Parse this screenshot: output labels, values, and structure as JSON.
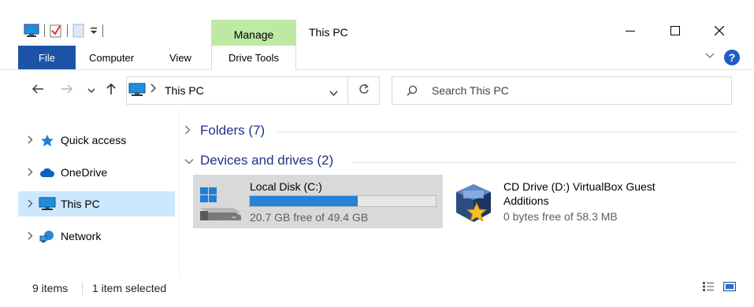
{
  "window": {
    "title": "This PC",
    "contextual_tab_group": "Manage",
    "contextual_color": "#bde9a4",
    "controls": {
      "minimize_icon": "minimize-icon",
      "maximize_icon": "maximize-icon",
      "close_icon": "close-icon"
    }
  },
  "quick_access_toolbar": {
    "icons": [
      "computer-properties-icon",
      "checkbox-icon",
      "new-folder-icon",
      "customize-dropdown-icon"
    ]
  },
  "ribbon": {
    "tabs": [
      {
        "label": "File",
        "active_color": "#1c53a7"
      },
      {
        "label": "Computer"
      },
      {
        "label": "View"
      },
      {
        "label": "Drive Tools"
      }
    ],
    "help_label": "?"
  },
  "address_bar": {
    "path": "This PC",
    "search_placeholder": "Search This PC"
  },
  "navigation_pane": {
    "items": [
      {
        "label": "Quick access",
        "icon": "star-icon",
        "selected": false
      },
      {
        "label": "OneDrive",
        "icon": "cloud-icon",
        "selected": false
      },
      {
        "label": "This PC",
        "icon": "monitor-icon",
        "selected": true
      },
      {
        "label": "Network",
        "icon": "network-icon",
        "selected": false
      }
    ]
  },
  "content": {
    "groups": [
      {
        "label": "Folders (7)",
        "expanded": false
      },
      {
        "label": "Devices and drives (2)",
        "expanded": true
      }
    ],
    "drives": [
      {
        "name": "Local Disk (C:)",
        "free_text": "20.7 GB free of 49.4 GB",
        "used_fraction": 0.581,
        "bar_color": "#2682d5",
        "selected": true,
        "icon": "windows-drive-icon"
      },
      {
        "name_line1": "CD Drive (D:) VirtualBox Guest",
        "name_line2": "Additions",
        "free_text": "0 bytes free of 58.3 MB",
        "selected": false,
        "icon": "virtualbox-icon"
      }
    ]
  },
  "status_bar": {
    "item_count": "9 items",
    "selection": "1 item selected"
  }
}
